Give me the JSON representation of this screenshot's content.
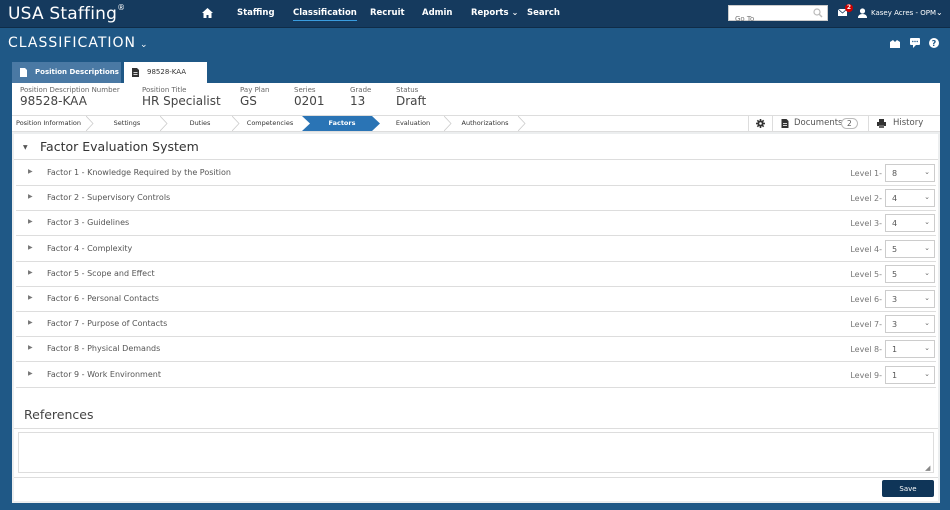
{
  "brand": {
    "name": "USA Staffing",
    "mark": "®"
  },
  "nav": {
    "items": [
      {
        "label": "Staffing"
      },
      {
        "label": "Classification",
        "active": true
      },
      {
        "label": "Recruit"
      },
      {
        "label": "Admin"
      },
      {
        "label": "Reports",
        "dropdown": true
      },
      {
        "label": "Search"
      }
    ],
    "goto_placeholder": "Go To",
    "mail_count": "2",
    "user": "Kasey Acres - OPM"
  },
  "module": {
    "title": "CLASSIFICATION",
    "chevron": "⌄"
  },
  "tabs": [
    {
      "label": "Position Descriptions"
    },
    {
      "label": "98528-KAA",
      "active": true
    }
  ],
  "info": [
    {
      "label": "Position Description Number",
      "value": "98528-KAA"
    },
    {
      "label": "Position Title",
      "value": "HR Specialist"
    },
    {
      "label": "Pay Plan",
      "value": "GS"
    },
    {
      "label": "Series",
      "value": "0201"
    },
    {
      "label": "Grade",
      "value": "13"
    },
    {
      "label": "Status",
      "value": "Draft"
    }
  ],
  "steps": [
    {
      "label": "Position Information"
    },
    {
      "label": "Settings"
    },
    {
      "label": "Duties"
    },
    {
      "label": "Competencies"
    },
    {
      "label": "Factors",
      "active": true
    },
    {
      "label": "Evaluation"
    },
    {
      "label": "Authorizations"
    }
  ],
  "tools": {
    "documents_label": "Documents",
    "documents_count": "2",
    "history_label": "History"
  },
  "fes": {
    "title": "Factor Evaluation System",
    "factors": [
      {
        "label": "Factor 1 - Knowledge Required by the Position",
        "level_label": "Level 1-",
        "value": "8"
      },
      {
        "label": "Factor 2 - Supervisory Controls",
        "level_label": "Level 2-",
        "value": "4"
      },
      {
        "label": "Factor 3 - Guidelines",
        "level_label": "Level 3-",
        "value": "4"
      },
      {
        "label": "Factor 4 - Complexity",
        "level_label": "Level 4-",
        "value": "5"
      },
      {
        "label": "Factor 5 - Scope and Effect",
        "level_label": "Level 5-",
        "value": "5"
      },
      {
        "label": "Factor 6 - Personal Contacts",
        "level_label": "Level 6-",
        "value": "3"
      },
      {
        "label": "Factor 7 - Purpose of Contacts",
        "level_label": "Level 7-",
        "value": "3"
      },
      {
        "label": "Factor 8 - Physical Demands",
        "level_label": "Level 8-",
        "value": "1"
      },
      {
        "label": "Factor 9 - Work Environment",
        "level_label": "Level 9-",
        "value": "1"
      }
    ]
  },
  "references": {
    "title": "References",
    "value": ""
  },
  "save_label": "Save",
  "colors": {
    "nav_bg": "#153a5e",
    "header_bg": "#1f5886",
    "active_step": "#2a74b5",
    "save_bg": "#0f3558",
    "badge": "#cc0000"
  }
}
